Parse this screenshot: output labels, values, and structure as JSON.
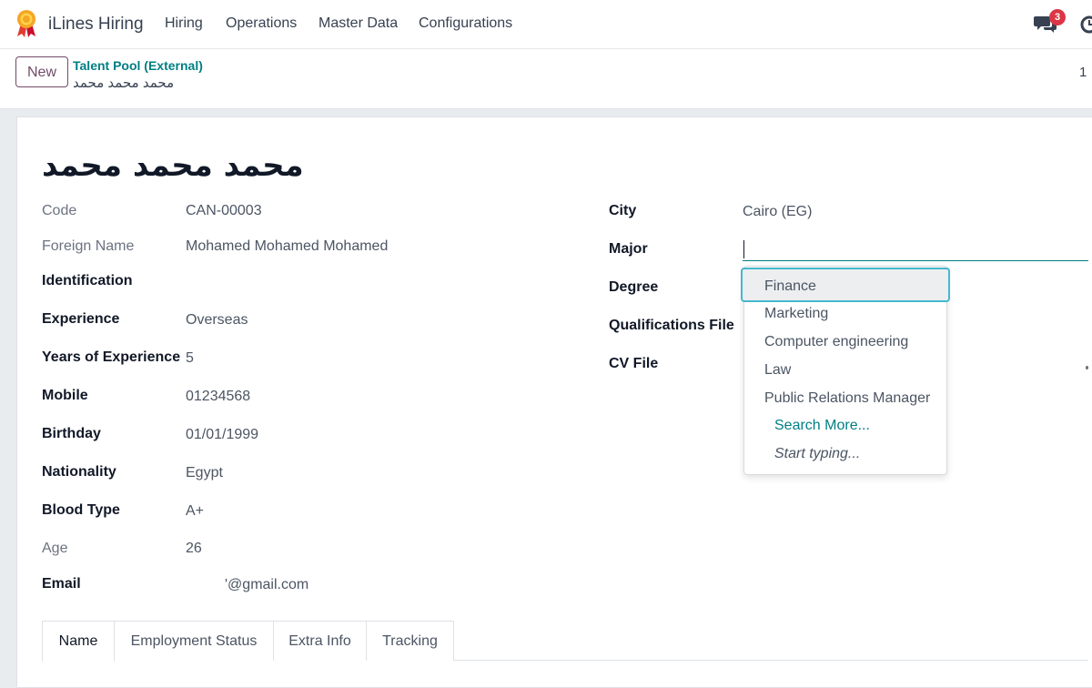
{
  "navbar": {
    "app_name": "iLines Hiring",
    "menu": [
      "Hiring",
      "Operations",
      "Master Data",
      "Configurations"
    ],
    "chat_count": "3"
  },
  "control_panel": {
    "new_label": "New",
    "breadcrumb": "Talent Pool (External)",
    "record_name": "محمد محمد محمد",
    "pager": "1"
  },
  "form": {
    "title": "محمد محمد محمد",
    "left": {
      "code_label": "Code",
      "code_value": "CAN-00003",
      "foreign_label": "Foreign Name",
      "foreign_value": "Mohamed Mohamed Mohamed",
      "identification_label": "Identification",
      "experience_label": "Experience",
      "experience_value": "Overseas",
      "years_label": "Years of Experience",
      "years_value": "5",
      "mobile_label": "Mobile",
      "mobile_value": "01234568",
      "birthday_label": "Birthday",
      "birthday_value": "01/01/1999",
      "nationality_label": "Nationality",
      "nationality_value": "Egypt",
      "blood_label": "Blood Type",
      "blood_value": "A+",
      "age_label": "Age",
      "age_value": "26",
      "email_label": "Email",
      "email_value": "'@gmail.com"
    },
    "right": {
      "city_label": "City",
      "city_value": "Cairo (EG)",
      "major_label": "Major",
      "major_value": "",
      "degree_label": "Degree",
      "qualifications_label": "Qualifications File",
      "cv_label": "CV File"
    }
  },
  "dropdown": {
    "items": [
      "Finance",
      "Marketing",
      "Computer engineering",
      "Law",
      "Public Relations Manager"
    ],
    "search_more": "Search More...",
    "start_typing": "Start typing..."
  },
  "tabs": [
    "Name",
    "Employment Status",
    "Extra Info",
    "Tracking"
  ],
  "colors": {
    "accent": "#017e84",
    "brand": "#714b67",
    "highlight_border": "#46b7cf",
    "badge": "#dc3545"
  }
}
